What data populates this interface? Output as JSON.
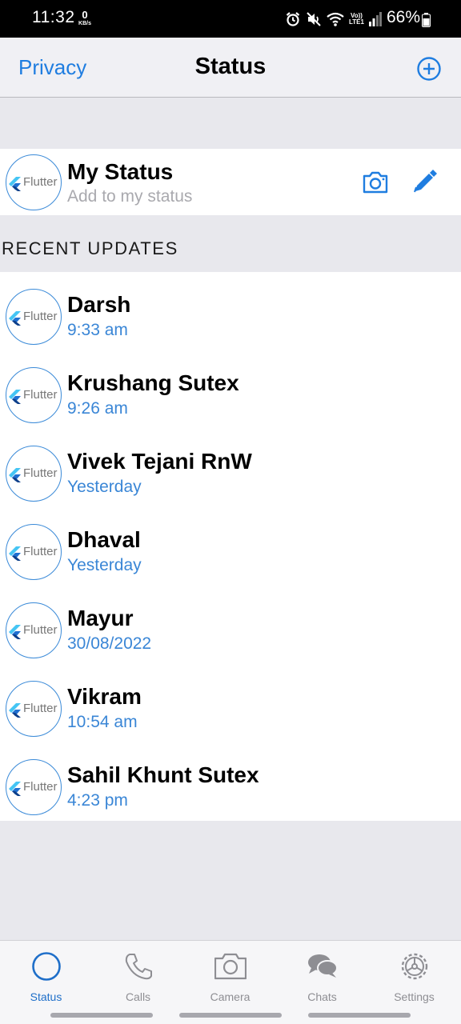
{
  "status_bar": {
    "time": "11:32",
    "net_speed_value": "0",
    "net_speed_unit": "KB/s",
    "volte_line1": "Vo))",
    "volte_line2": "LTE1",
    "battery": "66%"
  },
  "nav": {
    "left_label": "Privacy",
    "title": "Status"
  },
  "my_status": {
    "name": "My Status",
    "subtitle": "Add to my status",
    "avatar_text": "Flutter"
  },
  "recent_header": "RECENT UPDATES",
  "updates": [
    {
      "name": "Darsh",
      "time": "9:33 am",
      "avatar_text": "Flutter"
    },
    {
      "name": "Krushang Sutex",
      "time": "9:26 am",
      "avatar_text": "Flutter"
    },
    {
      "name": "Vivek Tejani RnW",
      "time": "Yesterday",
      "avatar_text": "Flutter"
    },
    {
      "name": "Dhaval",
      "time": "Yesterday",
      "avatar_text": "Flutter"
    },
    {
      "name": "Mayur",
      "time": "30/08/2022",
      "avatar_text": "Flutter"
    },
    {
      "name": "Vikram",
      "time": "10:54 am",
      "avatar_text": "Flutter"
    },
    {
      "name": "Sahil Khunt Sutex",
      "time": "4:23 pm",
      "avatar_text": "Flutter"
    }
  ],
  "tabs": [
    {
      "label": "Status",
      "icon": "status-ring-icon",
      "active": true
    },
    {
      "label": "Calls",
      "icon": "phone-icon",
      "active": false
    },
    {
      "label": "Camera",
      "icon": "camera-icon",
      "active": false
    },
    {
      "label": "Chats",
      "icon": "chat-bubbles-icon",
      "active": false
    },
    {
      "label": "Settings",
      "icon": "gear-icon",
      "active": false
    }
  ],
  "colors": {
    "accent": "#1f7de0",
    "time_text": "#3a86d6",
    "background": "#e8e8ed",
    "tab_active": "#1f6fc9",
    "tab_inactive": "#8e8e93"
  }
}
